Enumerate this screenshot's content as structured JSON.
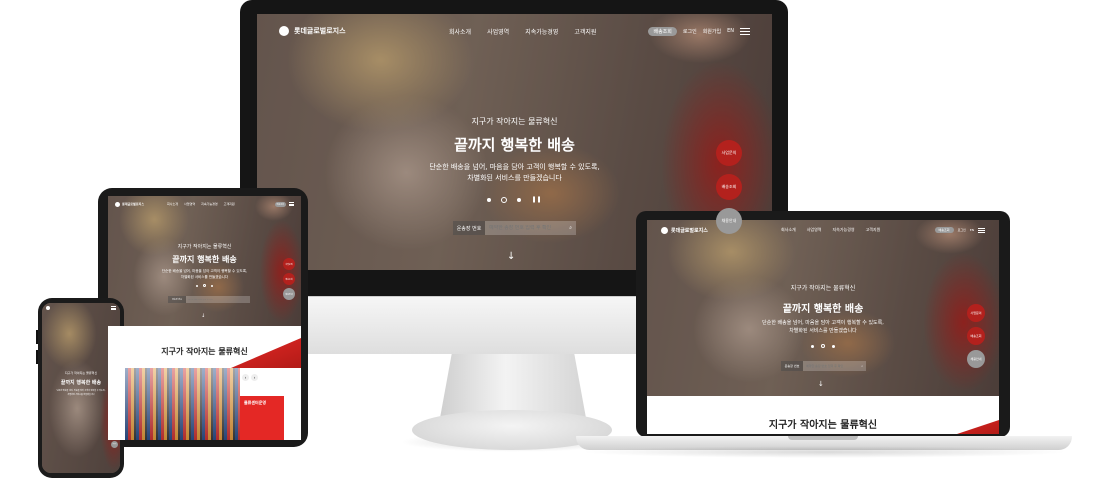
{
  "site": {
    "logo_text": "롯데글로벌로지스",
    "nav": [
      "회사소개",
      "사업영역",
      "지속가능경영",
      "고객지원"
    ],
    "pill_label": "배송조회",
    "util_links": [
      "로그인",
      "회원가입",
      "EN"
    ],
    "hero": {
      "kicker": "지구가 작아지는 물류혁신",
      "title": "끝까지 행복한 배송",
      "desc_line1": "단순한 배송을 넘어, 마음을 담아 고객이 행복할 수 있도록,",
      "desc_line2": "차별화된 서비스를 만들겠습니다"
    },
    "search": {
      "label": "운송장 번호",
      "placeholder": "예약한 송장 번호 입력 후 확인"
    },
    "side_menu": [
      "사업문의",
      "배송조회",
      "채용안내"
    ],
    "section_title": "지구가 작아지는 물류혁신",
    "card_title": "물류센터운영",
    "icons": {
      "scroll": "down-arrow-icon",
      "search": "search-icon",
      "menu": "hamburger-menu-icon",
      "pause": "pause-icon"
    }
  },
  "colors": {
    "brand_red": "#e42825",
    "pill_gray": "#9a9a9a"
  }
}
